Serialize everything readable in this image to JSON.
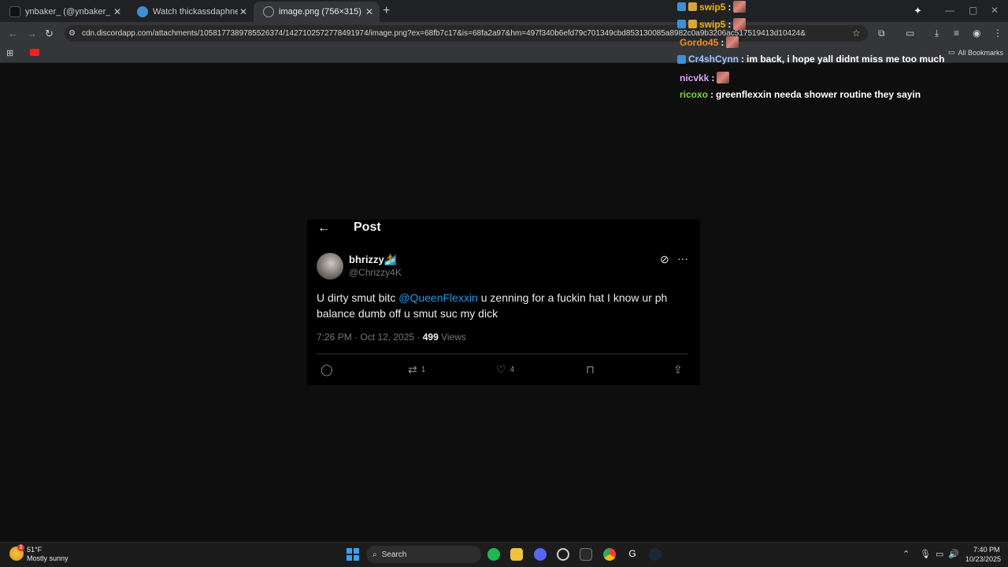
{
  "browser": {
    "tabs": [
      {
        "label": "ynbaker_ (@ynbaker_) | TikTok",
        "favicon_color": "#111111"
      },
      {
        "label": "Watch thickassdaphne | Stream",
        "favicon_color": "#3d8fd8"
      },
      {
        "label": "image.png (756×315)",
        "favicon_color": "#9aa0a6"
      }
    ],
    "url": "cdn.discordapp.com/attachments/1058177389785526374/1427102572778491974/image.png?ex=68fb7c17&is=68fa2a97&hm=497f340b6efd79c701349cbd853130085a8982c0a9b3206ac517519413d10424&",
    "bookmarks_label": "All Bookmarks"
  },
  "chat": [
    {
      "user": "swip5",
      "color": "#f2b705",
      "message": "",
      "emote": true
    },
    {
      "user": "swip5",
      "color": "#f2b705",
      "message": "",
      "emote": true
    },
    {
      "user": "Gordo45",
      "color": "#f08a24",
      "message": "",
      "emote": true
    },
    {
      "user": "Cr4shCynn",
      "color": "#9ec9ff",
      "message": "im back, i hope yall didnt miss me too much",
      "emote": false
    },
    {
      "user": "nicvkk",
      "color": "#d7a6ff",
      "message": "",
      "emote": true
    },
    {
      "user": "ricoxo",
      "color": "#7dd63a",
      "message": "greenflexxin needa shower routine they sayin",
      "emote": false
    }
  ],
  "post": {
    "header": "Post",
    "display_name": "bhrizzy🏄",
    "handle": "@Chrizzy4K",
    "text_before": "U dirty smut bitc ",
    "mention": "@QueenFlexxin",
    "text_after": " u zenning for a fuckin hat I know ur ph balance dumb off u smut suc my dick",
    "timestamp": "7:26 PM · Oct 12, 2025 · ",
    "views_count": "499",
    "views_label": " Views",
    "retweets": "1",
    "likes": "4"
  },
  "taskbar": {
    "weather_temp": "51°F",
    "weather_desc": "Mostly sunny",
    "weather_badge": "3",
    "search_label": "Search",
    "time": "7:40 PM",
    "date": "10/23/2025"
  }
}
